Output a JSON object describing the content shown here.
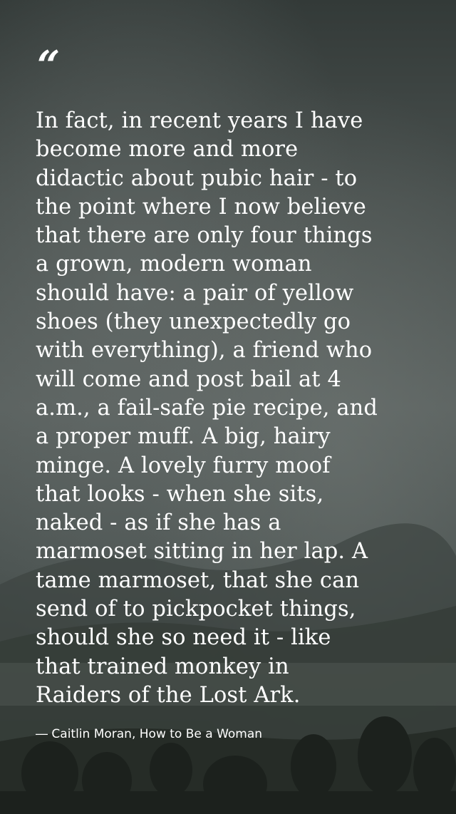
{
  "quote_mark": "“",
  "quote_lines": [
    "In fact, in recent years I have",
    "become more and more",
    "didactic about pubic hair - to",
    "the point where I now believe",
    "that there are only four things",
    "a grown, modern woman",
    "should have: a pair of yellow",
    "shoes (they unexpectedly go",
    "with everything), a friend who",
    "will come and post bail at 4",
    "a.m., a fail-safe pie recipe, and",
    "a proper muff. A big, hairy",
    "minge. A lovely furry moof",
    "that looks - when she sits,",
    "naked - as if she has a",
    "marmoset sitting in her lap. A",
    "tame marmoset, that she can",
    "send of to pickpocket things,",
    "should she so need it - like",
    "that trained monkey in",
    "Raiders of the Lost Ark."
  ],
  "attribution": "― Caitlin Moran, How to Be a Woman"
}
